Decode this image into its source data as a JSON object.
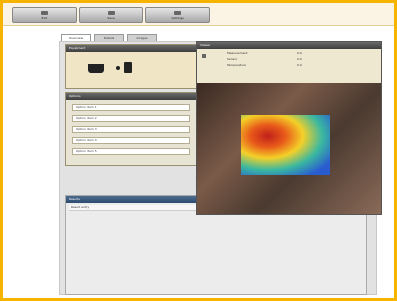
{
  "toolbar": {
    "buttons": [
      {
        "label": "Exit"
      },
      {
        "label": "Save"
      },
      {
        "label": "Settings"
      }
    ]
  },
  "tabs": [
    {
      "label": "Overview"
    },
    {
      "label": "Details"
    },
    {
      "label": "Images"
    }
  ],
  "panels": {
    "equipment": {
      "title": "Equipment"
    },
    "options": {
      "title": "Options",
      "items": [
        "Option item 1",
        "Option item 2",
        "Option item 3",
        "Option item 4",
        "Option item 5"
      ]
    },
    "results": {
      "title": "Results",
      "rows": [
        {
          "name": "Result entry",
          "value": "—"
        }
      ]
    }
  },
  "viewer": {
    "title": "Viewer",
    "info": {
      "label1": "Measurement",
      "value1": "0.0",
      "label2": "Sensor",
      "value2": "0.0",
      "label3": "Temperature",
      "value3": "0.0"
    }
  }
}
